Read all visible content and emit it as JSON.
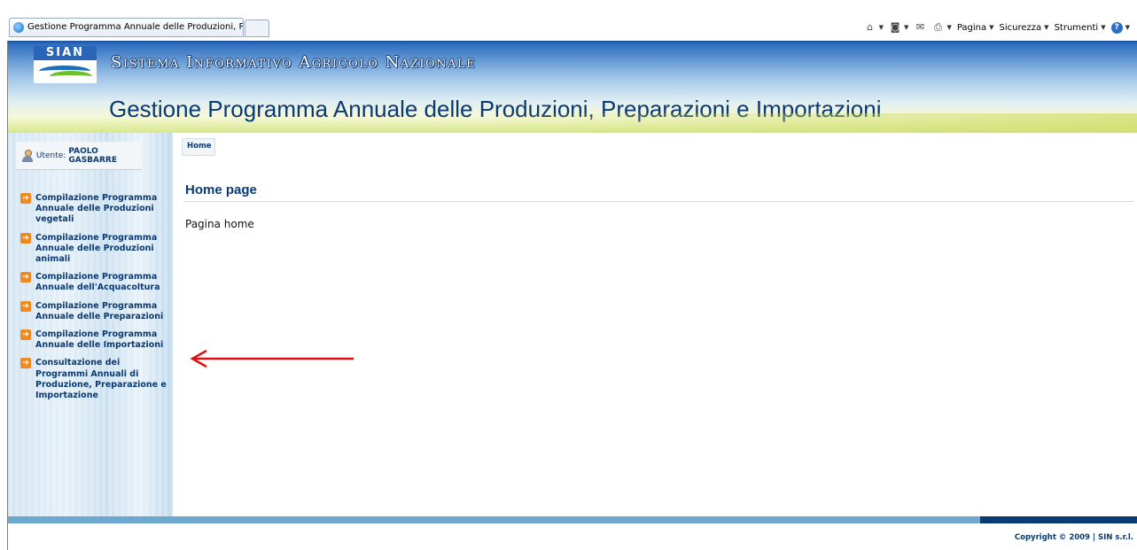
{
  "browser": {
    "tab_title": "Gestione Programma Annuale delle Produzioni, Prepar...",
    "toolbar": {
      "pagina": "Pagina",
      "sicurezza": "Sicurezza",
      "strumenti": "Strumenti"
    }
  },
  "header": {
    "logo_text": "SIAN",
    "system_title": "Sistema Informativo Agricolo Nazionale",
    "app_title": "Gestione Programma Annuale delle Produzioni, Preparazioni e Importazioni"
  },
  "user": {
    "label": "Utente:",
    "name": "PAOLO GASBARRE"
  },
  "sidebar": {
    "items": [
      {
        "label": "Compilazione Programma Annuale delle Produzioni vegetali"
      },
      {
        "label": "Compilazione Programma Annuale delle Produzioni animali"
      },
      {
        "label": "Compilazione Programma Annuale dell'Acquacoltura"
      },
      {
        "label": "Compilazione Programma Annuale delle Preparazioni"
      },
      {
        "label": "Compilazione Programma Annuale delle Importazioni"
      },
      {
        "label": "Consultazione dei Programmi Annuali di Produzione, Preparazione e Importazione"
      }
    ]
  },
  "main": {
    "breadcrumb": "Home",
    "title": "Home page",
    "text": "Pagina home"
  },
  "footer": {
    "copyright": "Copyright © 2009 | SIN s.r.l."
  },
  "colors": {
    "brand_blue": "#0b3a73",
    "menu_arrow": "#f08a1e",
    "annotation_arrow": "#e01010"
  }
}
